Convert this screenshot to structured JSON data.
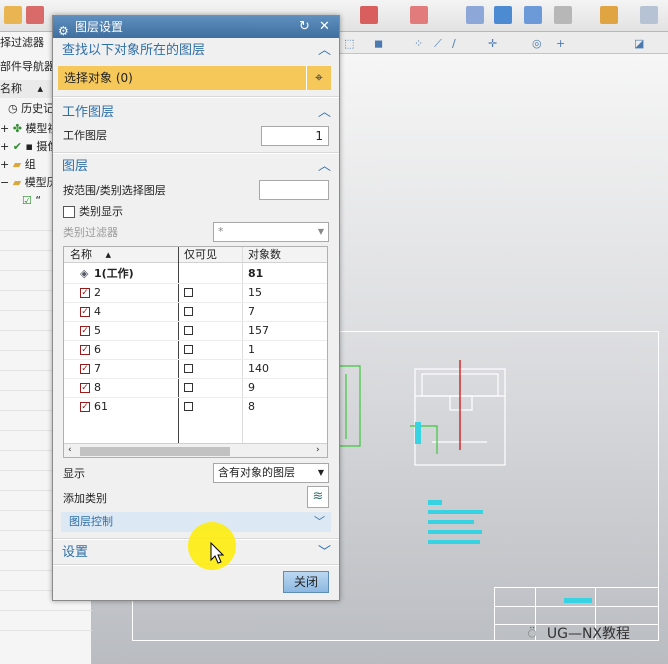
{
  "navigator": {
    "filter_label": "择过滤器",
    "nav_title": "部件导航器",
    "col_name": "名称",
    "items": [
      "历史记",
      "模型视",
      "摄像",
      "组",
      "模型历",
      "“"
    ]
  },
  "dialog": {
    "title": "图层设置",
    "sec_find": {
      "title": "查找以下对象所在的图层",
      "select_label": "选择对象 (0)"
    },
    "sec_work": {
      "title": "工作图层",
      "field_label": "工作图层",
      "field_value": "1"
    },
    "sec_layer": {
      "title": "图层",
      "range_label": "按范围/类别选择图层",
      "range_value": "",
      "category_display_label": "类别显示",
      "category_filter_label": "类别过滤器",
      "category_filter_value": "*",
      "table": {
        "headers": [
          "名称",
          "仅可见",
          "对象数"
        ],
        "rows": [
          {
            "name": "1(工作)",
            "count": "81"
          },
          {
            "name": "2",
            "count": "15"
          },
          {
            "name": "4",
            "count": "7"
          },
          {
            "name": "5",
            "count": "157"
          },
          {
            "name": "6",
            "count": "1"
          },
          {
            "name": "7",
            "count": "140"
          },
          {
            "name": "8",
            "count": "9"
          },
          {
            "name": "61",
            "count": "8"
          }
        ]
      },
      "display_label": "显示",
      "display_value": "含有对象的图层",
      "add_category_label": "添加类别",
      "layer_control_label": "图层控制"
    },
    "sec_settings": {
      "title": "设置"
    },
    "close_label": "关闭"
  },
  "watermark": "UG—NX教程",
  "colors": {
    "title_bar": "#4f7fae",
    "section_text": "#2f6fa8",
    "selection_highlight": "#f6c85a",
    "cursor_halo": "#ffec00",
    "drawing_cyan": "#37d3e3",
    "drawing_green": "#3fc63f"
  }
}
